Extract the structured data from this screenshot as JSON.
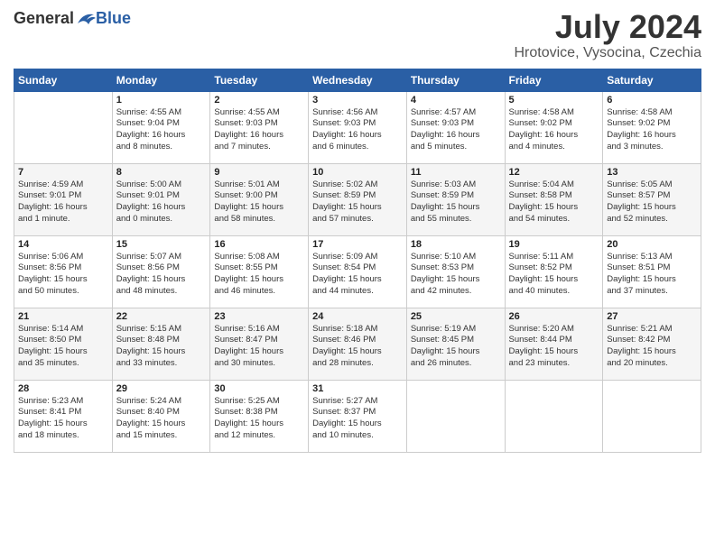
{
  "header": {
    "logo_general": "General",
    "logo_blue": "Blue",
    "title": "July 2024",
    "location": "Hrotovice, Vysocina, Czechia"
  },
  "days_of_week": [
    "Sunday",
    "Monday",
    "Tuesday",
    "Wednesday",
    "Thursday",
    "Friday",
    "Saturday"
  ],
  "weeks": [
    [
      {
        "day": "",
        "content": ""
      },
      {
        "day": "1",
        "content": "Sunrise: 4:55 AM\nSunset: 9:04 PM\nDaylight: 16 hours\nand 8 minutes."
      },
      {
        "day": "2",
        "content": "Sunrise: 4:55 AM\nSunset: 9:03 PM\nDaylight: 16 hours\nand 7 minutes."
      },
      {
        "day": "3",
        "content": "Sunrise: 4:56 AM\nSunset: 9:03 PM\nDaylight: 16 hours\nand 6 minutes."
      },
      {
        "day": "4",
        "content": "Sunrise: 4:57 AM\nSunset: 9:03 PM\nDaylight: 16 hours\nand 5 minutes."
      },
      {
        "day": "5",
        "content": "Sunrise: 4:58 AM\nSunset: 9:02 PM\nDaylight: 16 hours\nand 4 minutes."
      },
      {
        "day": "6",
        "content": "Sunrise: 4:58 AM\nSunset: 9:02 PM\nDaylight: 16 hours\nand 3 minutes."
      }
    ],
    [
      {
        "day": "7",
        "content": "Sunrise: 4:59 AM\nSunset: 9:01 PM\nDaylight: 16 hours\nand 1 minute."
      },
      {
        "day": "8",
        "content": "Sunrise: 5:00 AM\nSunset: 9:01 PM\nDaylight: 16 hours\nand 0 minutes."
      },
      {
        "day": "9",
        "content": "Sunrise: 5:01 AM\nSunset: 9:00 PM\nDaylight: 15 hours\nand 58 minutes."
      },
      {
        "day": "10",
        "content": "Sunrise: 5:02 AM\nSunset: 8:59 PM\nDaylight: 15 hours\nand 57 minutes."
      },
      {
        "day": "11",
        "content": "Sunrise: 5:03 AM\nSunset: 8:59 PM\nDaylight: 15 hours\nand 55 minutes."
      },
      {
        "day": "12",
        "content": "Sunrise: 5:04 AM\nSunset: 8:58 PM\nDaylight: 15 hours\nand 54 minutes."
      },
      {
        "day": "13",
        "content": "Sunrise: 5:05 AM\nSunset: 8:57 PM\nDaylight: 15 hours\nand 52 minutes."
      }
    ],
    [
      {
        "day": "14",
        "content": "Sunrise: 5:06 AM\nSunset: 8:56 PM\nDaylight: 15 hours\nand 50 minutes."
      },
      {
        "day": "15",
        "content": "Sunrise: 5:07 AM\nSunset: 8:56 PM\nDaylight: 15 hours\nand 48 minutes."
      },
      {
        "day": "16",
        "content": "Sunrise: 5:08 AM\nSunset: 8:55 PM\nDaylight: 15 hours\nand 46 minutes."
      },
      {
        "day": "17",
        "content": "Sunrise: 5:09 AM\nSunset: 8:54 PM\nDaylight: 15 hours\nand 44 minutes."
      },
      {
        "day": "18",
        "content": "Sunrise: 5:10 AM\nSunset: 8:53 PM\nDaylight: 15 hours\nand 42 minutes."
      },
      {
        "day": "19",
        "content": "Sunrise: 5:11 AM\nSunset: 8:52 PM\nDaylight: 15 hours\nand 40 minutes."
      },
      {
        "day": "20",
        "content": "Sunrise: 5:13 AM\nSunset: 8:51 PM\nDaylight: 15 hours\nand 37 minutes."
      }
    ],
    [
      {
        "day": "21",
        "content": "Sunrise: 5:14 AM\nSunset: 8:50 PM\nDaylight: 15 hours\nand 35 minutes."
      },
      {
        "day": "22",
        "content": "Sunrise: 5:15 AM\nSunset: 8:48 PM\nDaylight: 15 hours\nand 33 minutes."
      },
      {
        "day": "23",
        "content": "Sunrise: 5:16 AM\nSunset: 8:47 PM\nDaylight: 15 hours\nand 30 minutes."
      },
      {
        "day": "24",
        "content": "Sunrise: 5:18 AM\nSunset: 8:46 PM\nDaylight: 15 hours\nand 28 minutes."
      },
      {
        "day": "25",
        "content": "Sunrise: 5:19 AM\nSunset: 8:45 PM\nDaylight: 15 hours\nand 26 minutes."
      },
      {
        "day": "26",
        "content": "Sunrise: 5:20 AM\nSunset: 8:44 PM\nDaylight: 15 hours\nand 23 minutes."
      },
      {
        "day": "27",
        "content": "Sunrise: 5:21 AM\nSunset: 8:42 PM\nDaylight: 15 hours\nand 20 minutes."
      }
    ],
    [
      {
        "day": "28",
        "content": "Sunrise: 5:23 AM\nSunset: 8:41 PM\nDaylight: 15 hours\nand 18 minutes."
      },
      {
        "day": "29",
        "content": "Sunrise: 5:24 AM\nSunset: 8:40 PM\nDaylight: 15 hours\nand 15 minutes."
      },
      {
        "day": "30",
        "content": "Sunrise: 5:25 AM\nSunset: 8:38 PM\nDaylight: 15 hours\nand 12 minutes."
      },
      {
        "day": "31",
        "content": "Sunrise: 5:27 AM\nSunset: 8:37 PM\nDaylight: 15 hours\nand 10 minutes."
      },
      {
        "day": "",
        "content": ""
      },
      {
        "day": "",
        "content": ""
      },
      {
        "day": "",
        "content": ""
      }
    ]
  ]
}
